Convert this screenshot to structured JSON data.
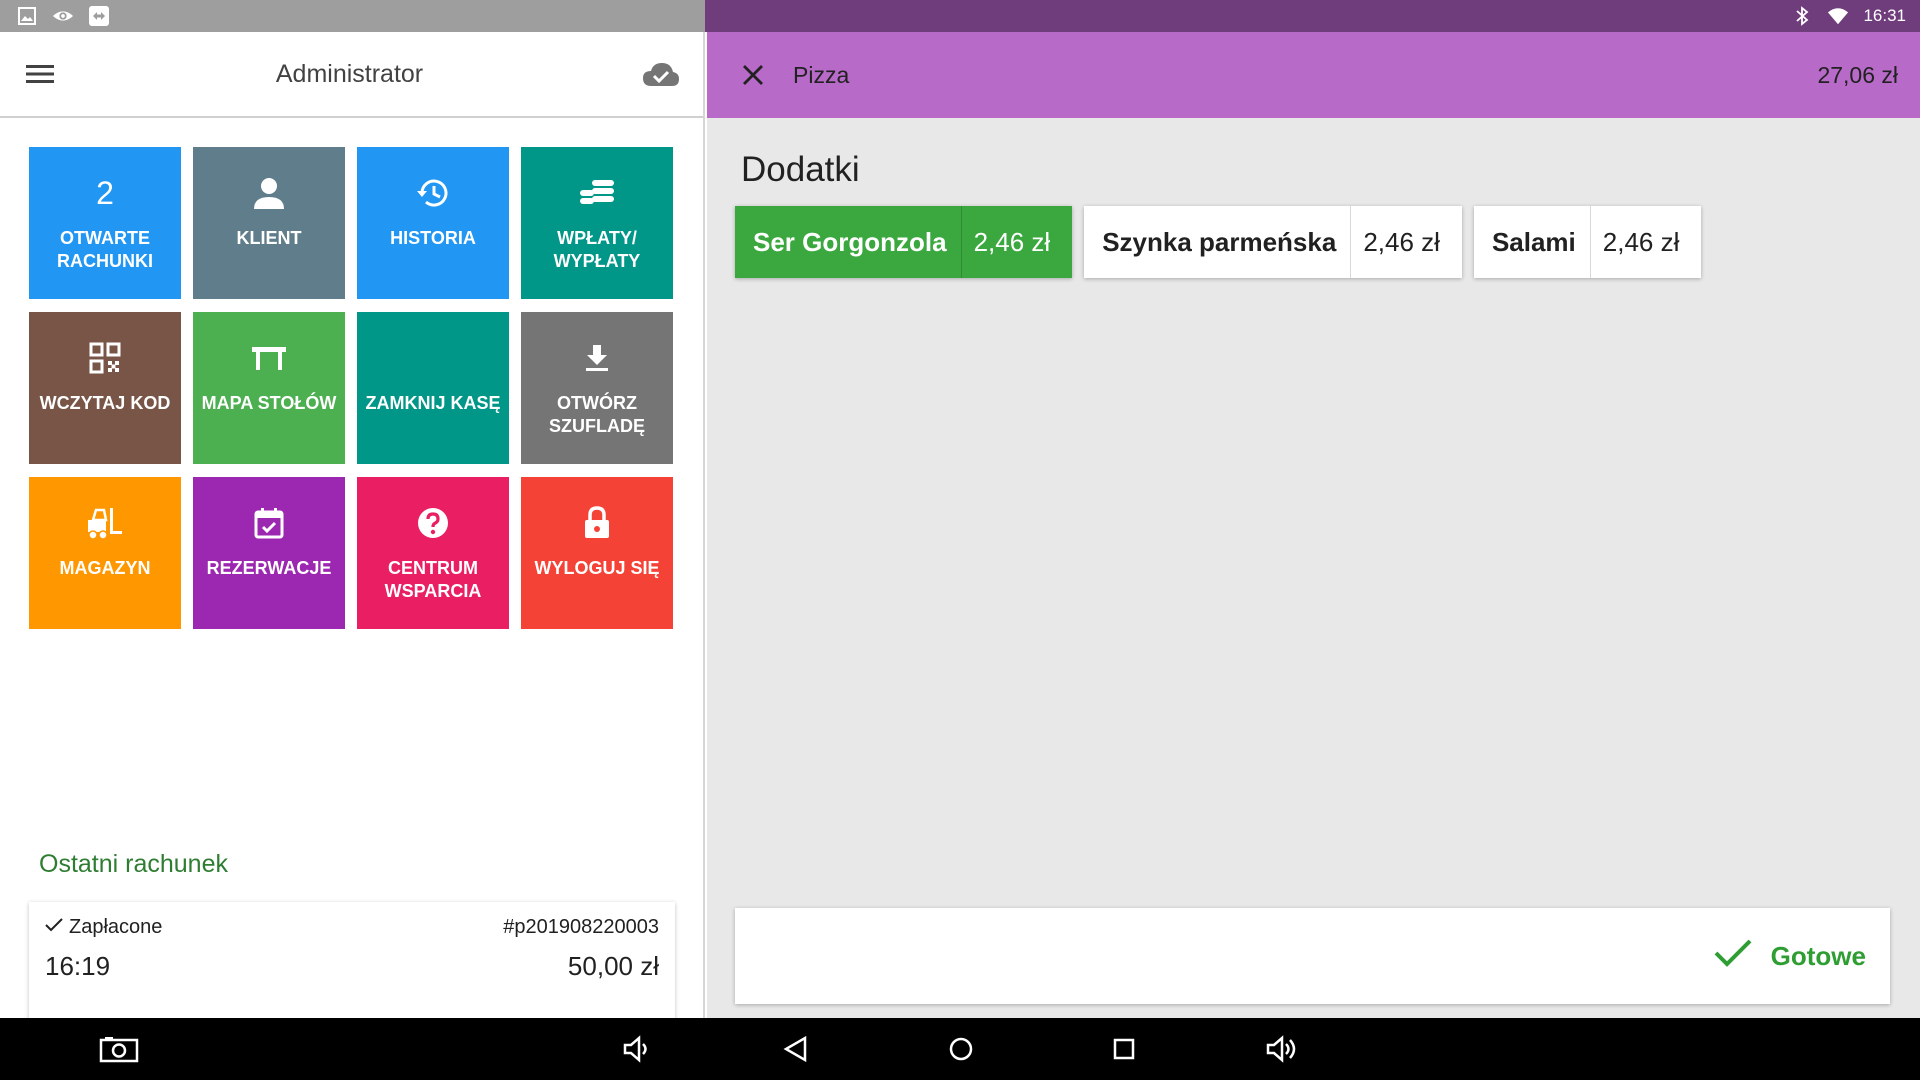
{
  "status_bar": {
    "time": "16:31",
    "left_icons": [
      "image-icon",
      "eye-icon",
      "remote-icon"
    ],
    "right_icons": [
      "bluetooth-icon",
      "wifi-icon"
    ]
  },
  "left_panel": {
    "header_title": "Administrator",
    "tiles": [
      {
        "id": "open-bills",
        "number": "2",
        "label": "OTWARTE RACHUNKI",
        "color": "#2196f3"
      },
      {
        "id": "client",
        "label": "KLIENT",
        "icon": "person-icon",
        "color": "#607d8b"
      },
      {
        "id": "history",
        "label": "HISTORIA",
        "icon": "history-icon",
        "color": "#2196f3"
      },
      {
        "id": "payments",
        "label": "WPŁATY/ WYPŁATY",
        "icon": "coins-icon",
        "color": "#009688"
      },
      {
        "id": "scan-code",
        "label": "WCZYTAJ KOD",
        "icon": "qr-code-icon",
        "color": "#795548"
      },
      {
        "id": "table-map",
        "label": "MAPA STOŁÓW",
        "icon": "table-icon",
        "color": "#4caf50"
      },
      {
        "id": "close-register",
        "label": "ZAMKNIJ KASĘ",
        "icon": "",
        "color": "#009688"
      },
      {
        "id": "open-drawer",
        "label": "OTWÓRZ SZUFLADĘ",
        "icon": "download-icon",
        "color": "#757575"
      },
      {
        "id": "warehouse",
        "label": "MAGAZYN",
        "icon": "forklift-icon",
        "color": "#ff9800"
      },
      {
        "id": "reservations",
        "label": "REZERWACJE",
        "icon": "calendar-check-icon",
        "color": "#9c27b0"
      },
      {
        "id": "support",
        "label": "CENTRUM WSPARCIA",
        "icon": "help-icon",
        "color": "#e91e63"
      },
      {
        "id": "logout",
        "label": "WYLOGUJ SIĘ",
        "icon": "lock-icon",
        "color": "#f44336"
      }
    ],
    "last_bill": {
      "section_title": "Ostatni rachunek",
      "status": "Zapłacone",
      "number": "#p201908220003",
      "time": "16:19",
      "amount": "50,00 zł"
    }
  },
  "right_panel": {
    "header_title": "Pizza",
    "header_total": "27,06 zł",
    "section_title": "Dodatki",
    "options": [
      {
        "name": "Ser Gorgonzola",
        "price": "2,46 zł",
        "selected": true
      },
      {
        "name": "Szynka parmeńska",
        "price": "2,46 zł",
        "selected": false
      },
      {
        "name": "Salami",
        "price": "2,46 zł",
        "selected": false
      }
    ],
    "done_label": "Gotowe"
  },
  "colors": {
    "accent_purple": "#b86ac8",
    "status_purple": "#6f3c7c",
    "selected_green": "#3aa83e",
    "done_green": "#2e9e33",
    "section_green": "#2e7d32"
  }
}
